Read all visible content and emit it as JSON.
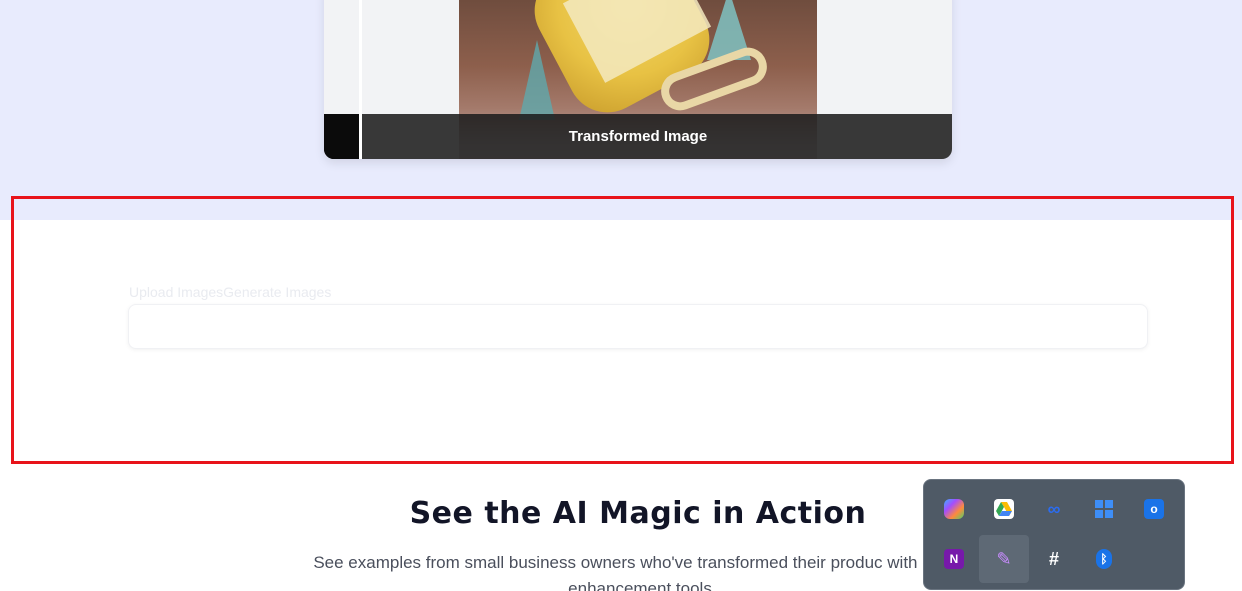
{
  "comparison": {
    "caption": "Transformed Image"
  },
  "uploader": {
    "tab_upload": "Upload Images",
    "tab_generate": "Generate Images"
  },
  "section": {
    "title": "See the AI Magic in Action",
    "subtitle": "See examples from small business owners who've transformed their produc with our AI enhancement tools"
  },
  "tray": {
    "icons": [
      {
        "name": "copilot-icon"
      },
      {
        "name": "google-drive-icon"
      },
      {
        "name": "meta-icon"
      },
      {
        "name": "task-manager-icon"
      },
      {
        "name": "outlook-icon"
      },
      {
        "name": "onenote-icon"
      },
      {
        "name": "quill-pen-icon"
      },
      {
        "name": "slack-icon"
      },
      {
        "name": "bluetooth-icon"
      }
    ]
  },
  "colors": {
    "highlight": "#e8131a",
    "hero_bg": "#e8ebfd",
    "title": "#121527"
  }
}
